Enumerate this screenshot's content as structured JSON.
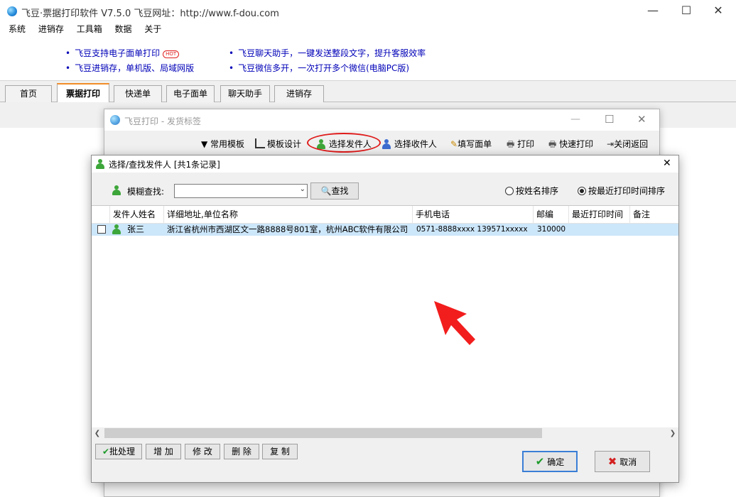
{
  "main_window": {
    "title": "飞豆·票据打印软件 V7.5.0   飞豆网址：http://www.f-dou.com",
    "controls": {
      "minimize": "—",
      "maximize": "☐",
      "close": "✕"
    },
    "menu": [
      "系统",
      "进销存",
      "工具箱",
      "数据",
      "关于"
    ],
    "banner": {
      "left": [
        "飞豆支持电子面单打印",
        "飞豆进销存，单机版、局域网版"
      ],
      "right": [
        "飞豆聊天助手，一键发送整段文字，提升客服效率",
        "飞豆微信多开，一次打开多个微信(电脑PC版)"
      ],
      "hot": "HOT"
    },
    "tabs": [
      "首页",
      "票据打印",
      "快递单",
      "电子面单",
      "聊天助手",
      "进销存"
    ],
    "active_tab": "票据打印"
  },
  "label_window": {
    "title": "飞豆打印 - 发货标签",
    "toolbar": [
      "常用模板",
      "模板设计",
      "选择发件人",
      "选择收件人",
      "填写面单",
      "打印",
      "快速打印",
      "关闭返回"
    ]
  },
  "dialog": {
    "title": "选择/查找发件人  [共1条记录]",
    "search_label": "模糊查找:",
    "search_value": "",
    "search_button": "查找",
    "sort_options": [
      "按姓名排序",
      "按最近打印时间排序"
    ],
    "sort_selected": "按最近打印时间排序",
    "columns": [
      "发件人姓名",
      "详细地址,单位名称",
      "手机电话",
      "邮编",
      "最近打印时间",
      "备注"
    ],
    "rows": [
      {
        "name": "张三",
        "address": "浙江省杭州市西湖区文一路8888号801室，杭州ABC软件有限公司",
        "phone": "0571-8888xxxx 139571xxxxx",
        "zip": "310000",
        "last_print": "",
        "note": ""
      }
    ],
    "buttons": [
      "批处理",
      "增 加",
      "修 改",
      "删 除",
      "复 制"
    ],
    "ok": "确定",
    "cancel": "取消"
  },
  "colors": {
    "link": "#0000b8",
    "highlight_row": "#cce6fa",
    "annotation": "#e01b1b",
    "tab_accent": "#f28c28"
  }
}
